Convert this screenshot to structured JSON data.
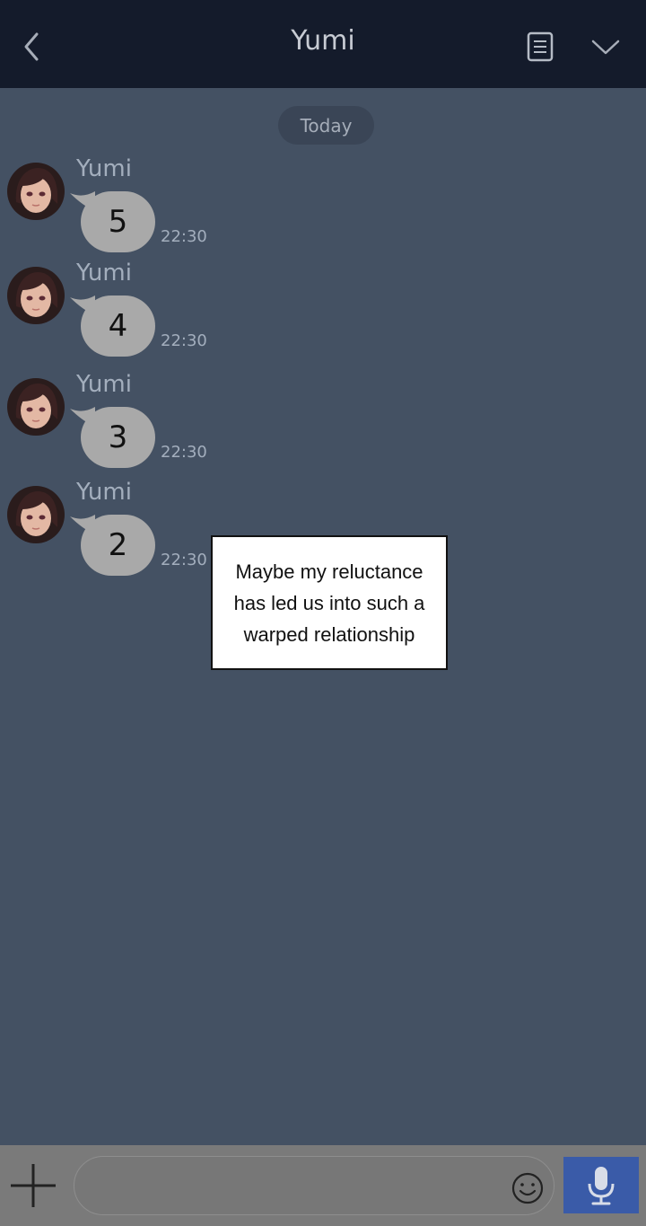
{
  "header": {
    "title": "Yumi",
    "back_icon": "chevron-left-icon",
    "notes_icon": "notes-icon",
    "menu_icon": "chevron-down-icon"
  },
  "chat": {
    "date_divider": "Today",
    "messages": [
      {
        "sender": "Yumi",
        "text": "5",
        "time": "22:30"
      },
      {
        "sender": "Yumi",
        "text": "4",
        "time": "22:30"
      },
      {
        "sender": "Yumi",
        "text": "3",
        "time": "22:30"
      },
      {
        "sender": "Yumi",
        "text": "2",
        "time": "22:30"
      }
    ]
  },
  "caption": {
    "text": "Maybe my reluctance has led us into such a warped relationship"
  },
  "composer": {
    "placeholder": "",
    "add_icon": "plus-icon",
    "emoji_icon": "smiley-icon",
    "mic_icon": "microphone-icon"
  },
  "colors": {
    "header_bg": "#141b2b",
    "chat_bg": "#445163",
    "bubble_bg": "#a9a9a9",
    "accent_mic": "#3a5ba8",
    "composer_bg": "#7a7a7a"
  }
}
